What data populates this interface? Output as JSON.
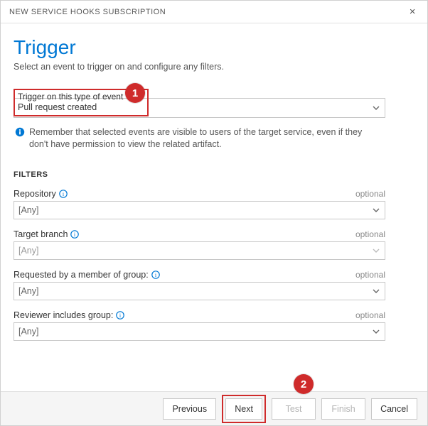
{
  "dialog": {
    "title": "NEW SERVICE HOOKS SUBSCRIPTION"
  },
  "header": {
    "title": "Trigger",
    "subtitle": "Select an event to trigger on and configure any filters."
  },
  "event": {
    "label": "Trigger on this type of event",
    "value": "Pull request created"
  },
  "note": "Remember that selected events are visible to users of the target service, even if they don't have permission to view the related artifact.",
  "filters": {
    "heading": "FILTERS",
    "optional_label": "optional",
    "items": [
      {
        "label": "Repository",
        "value": "[Any]",
        "has_help": true
      },
      {
        "label": "Target branch",
        "value": "[Any]",
        "has_help": true,
        "disabled": true
      },
      {
        "label": "Requested by a member of group:",
        "value": "[Any]",
        "has_help": true
      },
      {
        "label": "Reviewer includes group:",
        "value": "[Any]",
        "has_help": true
      }
    ]
  },
  "buttons": {
    "previous": "Previous",
    "next": "Next",
    "test": "Test",
    "finish": "Finish",
    "cancel": "Cancel"
  },
  "callouts": {
    "one": "1",
    "two": "2"
  }
}
